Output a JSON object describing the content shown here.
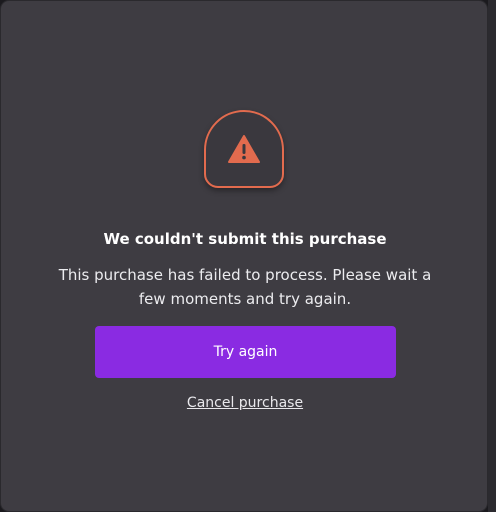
{
  "dialog": {
    "icon": "warning-triangle-icon",
    "title": "We couldn't submit this purchase",
    "message": "This purchase has failed to process. Please wait a few moments and try again.",
    "primary_button_label": "Try again",
    "secondary_link_label": "Cancel purchase"
  },
  "colors": {
    "backdrop": "#1b1a1e",
    "dialog_background": "#3e3c42",
    "accent_warning": "#e26b4e",
    "primary_button": "#8a2be2",
    "text_primary": "#ffffff"
  }
}
